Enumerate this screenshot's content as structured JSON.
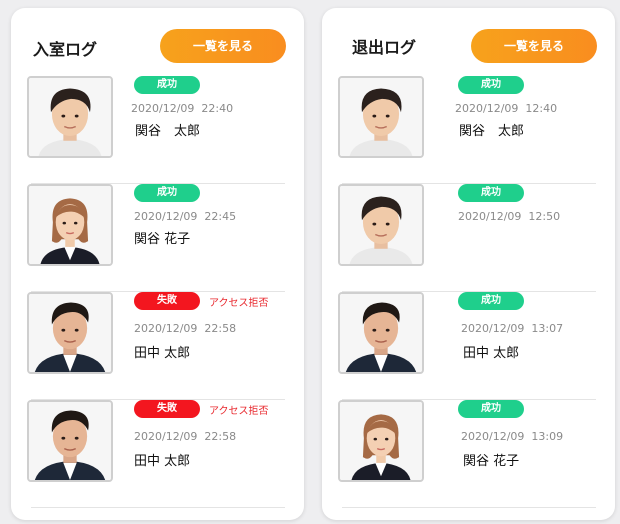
{
  "entry_log": {
    "title": "入室ログ",
    "view_all_label": "一覧を見る",
    "items": [
      {
        "status": "成功",
        "status_type": "success",
        "reason": "",
        "datetime": "2020/12/09  22:40",
        "name": "関谷　太郎",
        "avatar": "male-portrait-1"
      },
      {
        "status": "成功",
        "status_type": "success",
        "reason": "",
        "datetime": "2020/12/09  22:45",
        "name": "関谷 花子",
        "avatar": "female-portrait"
      },
      {
        "status": "失敗",
        "status_type": "fail",
        "reason": "アクセス拒否",
        "datetime": "2020/12/09  22:58",
        "name": "田中 太郎",
        "avatar": "male-portrait-2"
      },
      {
        "status": "失敗",
        "status_type": "fail",
        "reason": "アクセス拒否",
        "datetime": "2020/12/09  22:58",
        "name": "田中 太郎",
        "avatar": "male-portrait-2"
      }
    ]
  },
  "exit_log": {
    "title": "退出ログ",
    "view_all_label": "一覧を見る",
    "items": [
      {
        "status": "成功",
        "status_type": "success",
        "reason": "",
        "datetime": "2020/12/09  12:40",
        "name": "関谷　太郎",
        "avatar": "male-portrait-1"
      },
      {
        "status": "成功",
        "status_type": "success",
        "reason": "",
        "datetime": "2020/12/09  12:50",
        "name": "",
        "avatar": "male-portrait-1"
      },
      {
        "status": "成功",
        "status_type": "success",
        "reason": "",
        "datetime": "2020/12/09  13:07",
        "name": "田中 太郎",
        "avatar": "male-portrait-2"
      },
      {
        "status": "成功",
        "status_type": "success",
        "reason": "",
        "datetime": "2020/12/09  13:09",
        "name": "関谷 花子",
        "avatar": "female-portrait"
      }
    ]
  },
  "colors": {
    "success": "#1fcf8c",
    "fail": "#f3161f",
    "accent": "#f7a21c"
  }
}
